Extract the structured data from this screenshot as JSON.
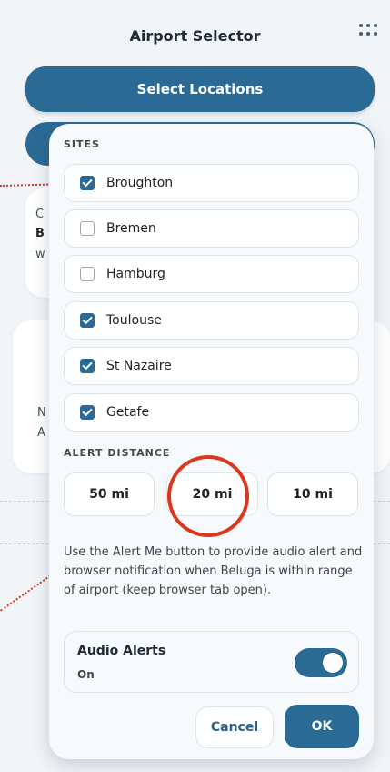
{
  "app": {
    "title": "Airport Selector",
    "select_locations_label": "Select Locations"
  },
  "background": {
    "peek_1": [
      "C",
      "B",
      "w"
    ],
    "peek_2": [
      "N",
      "A"
    ]
  },
  "modal": {
    "sites_label": "SITES",
    "sites": [
      {
        "label": "Broughton",
        "checked": true
      },
      {
        "label": "Bremen",
        "checked": false
      },
      {
        "label": "Hamburg",
        "checked": false
      },
      {
        "label": "Toulouse",
        "checked": true
      },
      {
        "label": "St Nazaire",
        "checked": true
      },
      {
        "label": "Getafe",
        "checked": true
      }
    ],
    "alert_distance_label": "ALERT DISTANCE",
    "distances": [
      "50 mi",
      "20 mi",
      "10 mi"
    ],
    "selected_distance": "20 mi",
    "help_text": "Use the Alert Me button to provide audio alert and browser notification when Beluga is within range of airport (keep browser tab open).",
    "audio_alerts": {
      "title": "Audio Alerts",
      "status": "On",
      "enabled": true
    },
    "cancel_label": "Cancel",
    "ok_label": "OK"
  },
  "colors": {
    "accent": "#2b6a95",
    "highlight": "#d9371e"
  }
}
